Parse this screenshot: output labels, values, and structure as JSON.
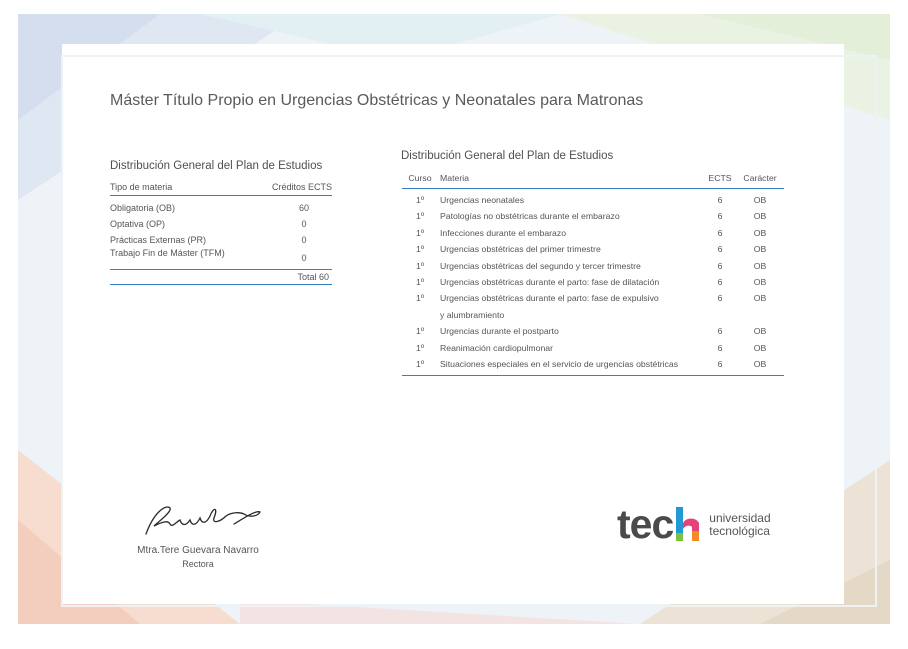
{
  "document": {
    "title": "Máster Título Propio en Urgencias Obstétricas y Neonatales para Matronas"
  },
  "summary_table": {
    "heading": "Distribución General del Plan de Estudios",
    "col_type": "Tipo de materia",
    "col_credits": "Créditos ECTS",
    "rows": [
      {
        "type": "Obligatoria (OB)",
        "credits": "60"
      },
      {
        "type": "Optativa (OP)",
        "credits": "0"
      },
      {
        "type": "Prácticas Externas (PR)",
        "credits": "0"
      },
      {
        "type": "Trabajo Fin de Máster (TFM)",
        "credits": "0"
      }
    ],
    "total": "Total 60"
  },
  "subjects_table": {
    "heading": "Distribución General del Plan de Estudios",
    "headers": {
      "course": "Curso",
      "subject": "Materia",
      "ects": "ECTS",
      "character": "Carácter"
    },
    "rows": [
      {
        "course": "1º",
        "subject": "Urgencias neonatales",
        "ects": "6",
        "character": "OB"
      },
      {
        "course": "1º",
        "subject": "Patologías no obstétricas durante el embarazo",
        "ects": "6",
        "character": "OB"
      },
      {
        "course": "1º",
        "subject": "Infecciones durante el embarazo",
        "ects": "6",
        "character": "OB"
      },
      {
        "course": "1º",
        "subject": "Urgencias obstétricas del primer trimestre",
        "ects": "6",
        "character": "OB"
      },
      {
        "course": "1º",
        "subject": "Urgencias obstétricas del segundo y tercer trimestre",
        "ects": "6",
        "character": "OB"
      },
      {
        "course": "1º",
        "subject": "Urgencias obstétricas durante el parto: fase de dilatación",
        "ects": "6",
        "character": "OB"
      },
      {
        "course": "1º",
        "subject": "Urgencias obstétricas durante el parto: fase de expulsivo",
        "subject_line2": "y alumbramiento",
        "ects": "6",
        "character": "OB"
      },
      {
        "course": "1º",
        "subject": "Urgencias durante el postparto",
        "ects": "6",
        "character": "OB"
      },
      {
        "course": "1º",
        "subject": "Reanimación cardiopulmonar",
        "ects": "6",
        "character": "OB"
      },
      {
        "course": "1º",
        "subject": "Situaciones especiales en el servicio de urgencias obstétricas",
        "ects": "6",
        "character": "OB"
      }
    ]
  },
  "signature": {
    "name": "Mtra.Tere Guevara Navarro",
    "role": "Rectora"
  },
  "logo": {
    "wordmark": "tec",
    "line1": "universidad",
    "line2": "tecnológica"
  },
  "colors": {
    "accent": "#3a7fc1",
    "logo_blue": "#1f9ad6",
    "logo_orange": "#f28c28",
    "logo_pink": "#e6427a",
    "logo_green": "#7cc242"
  }
}
